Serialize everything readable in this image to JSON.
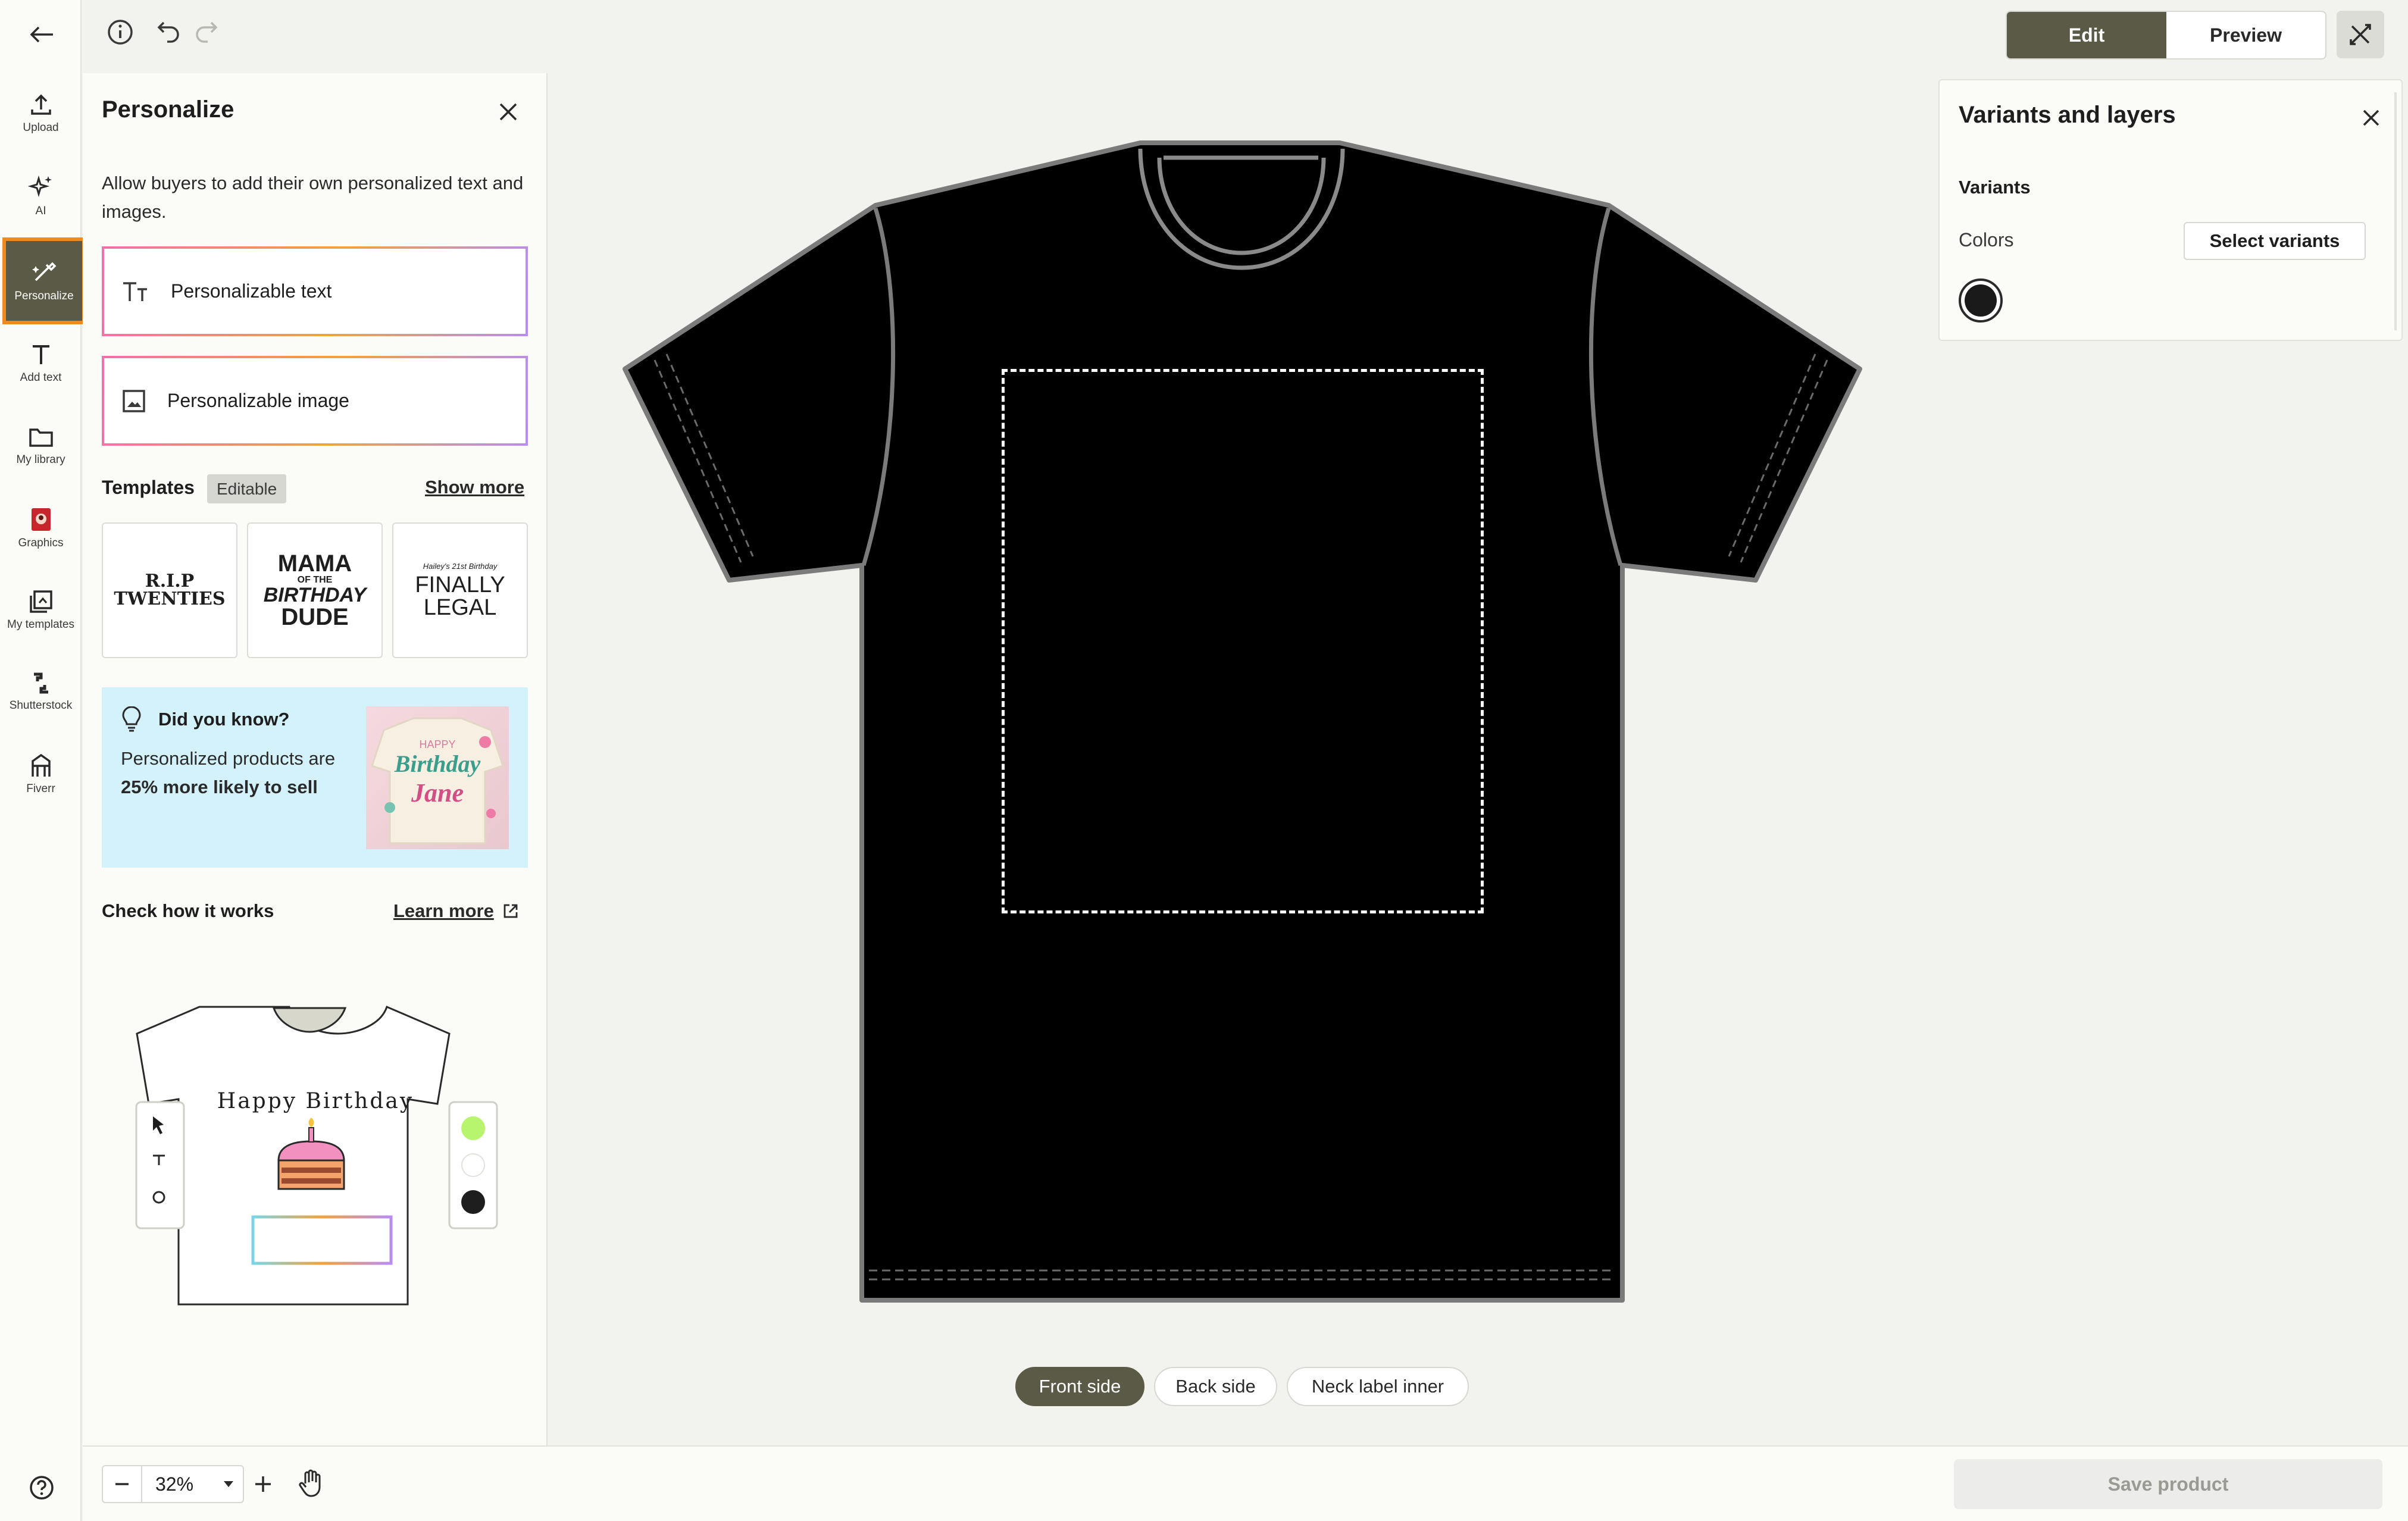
{
  "rail": {
    "items": [
      {
        "label": "Upload",
        "icon": "upload-icon"
      },
      {
        "label": "AI",
        "icon": "sparkle-icon"
      },
      {
        "label": "Personalize",
        "icon": "personalize-icon",
        "active": true
      },
      {
        "label": "Add text",
        "icon": "text-icon"
      },
      {
        "label": "My library",
        "icon": "folder-icon"
      },
      {
        "label": "Graphics",
        "icon": "graphics-icon"
      },
      {
        "label": "My templates",
        "icon": "templates-icon"
      },
      {
        "label": "Shutterstock",
        "icon": "shutterstock-icon"
      },
      {
        "label": "Fiverr",
        "icon": "fiverr-icon"
      }
    ]
  },
  "header": {
    "edit_label": "Edit",
    "preview_label": "Preview"
  },
  "personalize": {
    "title": "Personalize",
    "description": "Allow buyers to add their own personalized text and images.",
    "text_option": "Personalizable text",
    "image_option": "Personalizable image",
    "templates_label": "Templates",
    "editable_badge": "Editable",
    "show_more": "Show more",
    "templates": [
      {
        "line1": "R.I.P",
        "line2": "TWENTIES"
      },
      {
        "line1": "MAMA",
        "line2": "OF THE",
        "line3": "BIRTHDAY",
        "line4": "DUDE"
      },
      {
        "line1": "Hailey's 21st Birthday",
        "line2": "FINALLY",
        "line3": "LEGAL"
      }
    ],
    "tip": {
      "title": "Did you know?",
      "text_before": "Personalized products are ",
      "text_bold": "25% more likely to sell",
      "image_text1": "HAPPY",
      "image_text2": "Birthday",
      "image_text3": "Jane"
    },
    "how_it_works": "Check how it works",
    "learn_more": "Learn more",
    "demo_text": "Happy Birthday",
    "demo_colors": [
      "#b8f56e",
      "#ffffff",
      "#1e1e1e"
    ]
  },
  "variants": {
    "title": "Variants and layers",
    "section": "Variants",
    "colors_label": "Colors",
    "select_button": "Select variants",
    "selected_color": "#1a1a1a"
  },
  "canvas": {
    "shirt_color": "#000000",
    "tabs": [
      "Front side",
      "Back side",
      "Neck label inner"
    ],
    "active_tab": "Front side"
  },
  "bottom": {
    "zoom": "32%",
    "save_label": "Save product"
  },
  "colors": {
    "accent": "#5a5a46",
    "highlight": "#ef8a1e"
  }
}
